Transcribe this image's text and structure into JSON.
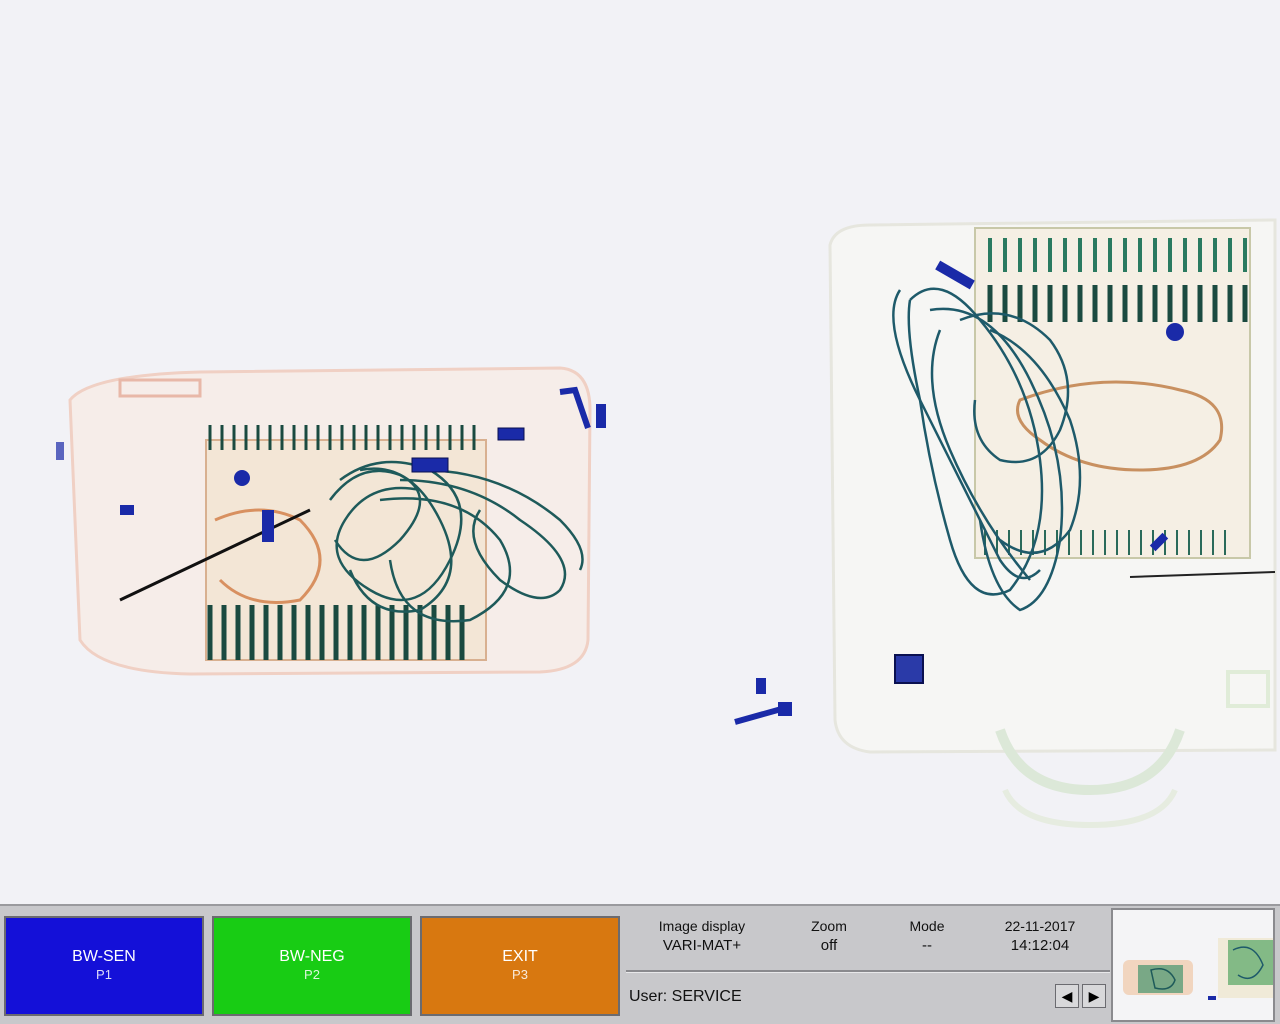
{
  "app": {
    "type": "x-ray baggage scanner display"
  },
  "function_keys": [
    {
      "label": "BW-SEN",
      "key": "P1",
      "color": "#1410d8"
    },
    {
      "label": "BW-NEG",
      "key": "P2",
      "color": "#18cc14"
    },
    {
      "label": "EXIT",
      "key": "P3",
      "color": "#d87810"
    }
  ],
  "status": {
    "image_display": {
      "label": "Image display",
      "value": "VARI-MAT+"
    },
    "zoom": {
      "label": "Zoom",
      "value": "off"
    },
    "mode": {
      "label": "Mode",
      "value": "--"
    },
    "date": "22-11-2017",
    "time": "14:12:04"
  },
  "user": {
    "text": "User: SERVICE"
  },
  "nav": {
    "prev_icon": "left-triangle-icon",
    "next_icon": "right-triangle-icon"
  },
  "colors": {
    "organic": "#e8a080",
    "inorganic": "#2a7a50",
    "metal": "#1a2aa8",
    "background": "#f2f2f6"
  }
}
